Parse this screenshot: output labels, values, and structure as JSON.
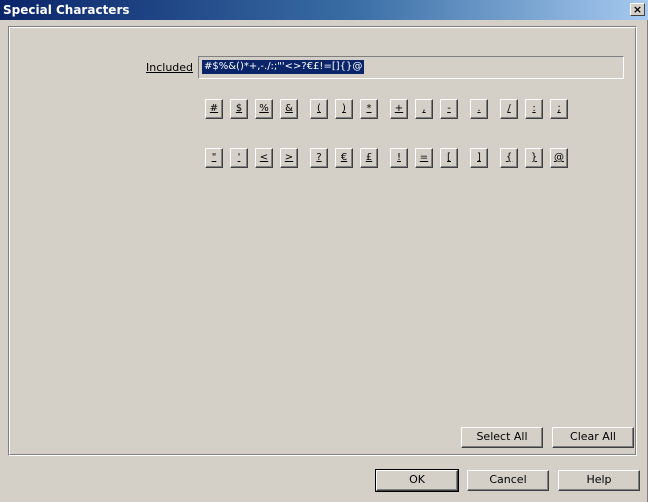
{
  "window": {
    "title": "Special Characters",
    "close_label": "×"
  },
  "included": {
    "label": "Included",
    "value": "#$%&()*+,-./:;\"'<>?€£!=[]{}@"
  },
  "row1": [
    "#",
    "$",
    "%",
    "&",
    "(",
    ")",
    "*",
    "+",
    ",",
    "-",
    ".",
    "/",
    ":",
    ";"
  ],
  "row2": [
    "\"",
    "'",
    "<",
    ">",
    "?",
    "€",
    "£",
    "!",
    "=",
    "[",
    "]",
    "{",
    "}",
    "@"
  ],
  "buttons": {
    "select_all": "Select All",
    "clear_all": "Clear All",
    "ok": "OK",
    "cancel": "Cancel",
    "help": "Help"
  }
}
